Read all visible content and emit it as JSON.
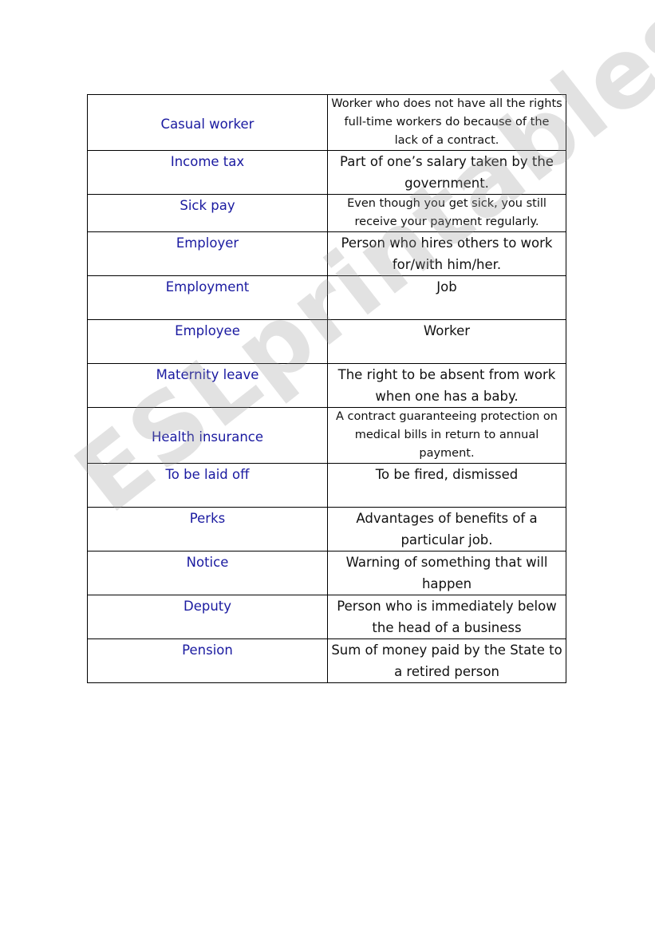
{
  "watermark": "ESLprintables.com",
  "rows": [
    {
      "term": "Casual worker",
      "definition": "Worker who does not have all the rights full-time workers do because of the lack of a contract."
    },
    {
      "term": "Income tax",
      "definition": "Part of one’s salary taken by the government."
    },
    {
      "term": "Sick pay",
      "definition": "Even though you get sick, you still receive your payment regularly."
    },
    {
      "term": "Employer",
      "definition": "Person who hires others to work for/with him/her."
    },
    {
      "term": "Employment",
      "definition": "Job"
    },
    {
      "term": "Employee",
      "definition": "Worker"
    },
    {
      "term": "Maternity leave",
      "definition": "The right to be absent from work when one has a baby."
    },
    {
      "term": "Health insurance",
      "definition": "A contract guaranteeing protection on medical bills in return to annual payment."
    },
    {
      "term": "To be laid off",
      "definition": "To be fired, dismissed"
    },
    {
      "term": "Perks",
      "definition": "Advantages of benefits of a particular job."
    },
    {
      "term": "Notice",
      "definition": "Warning of something that will happen"
    },
    {
      "term": "Deputy",
      "definition": "Person who is immediately below the head of a business"
    },
    {
      "term": "Pension",
      "definition": "Sum of money paid by the State to a retired person"
    }
  ]
}
